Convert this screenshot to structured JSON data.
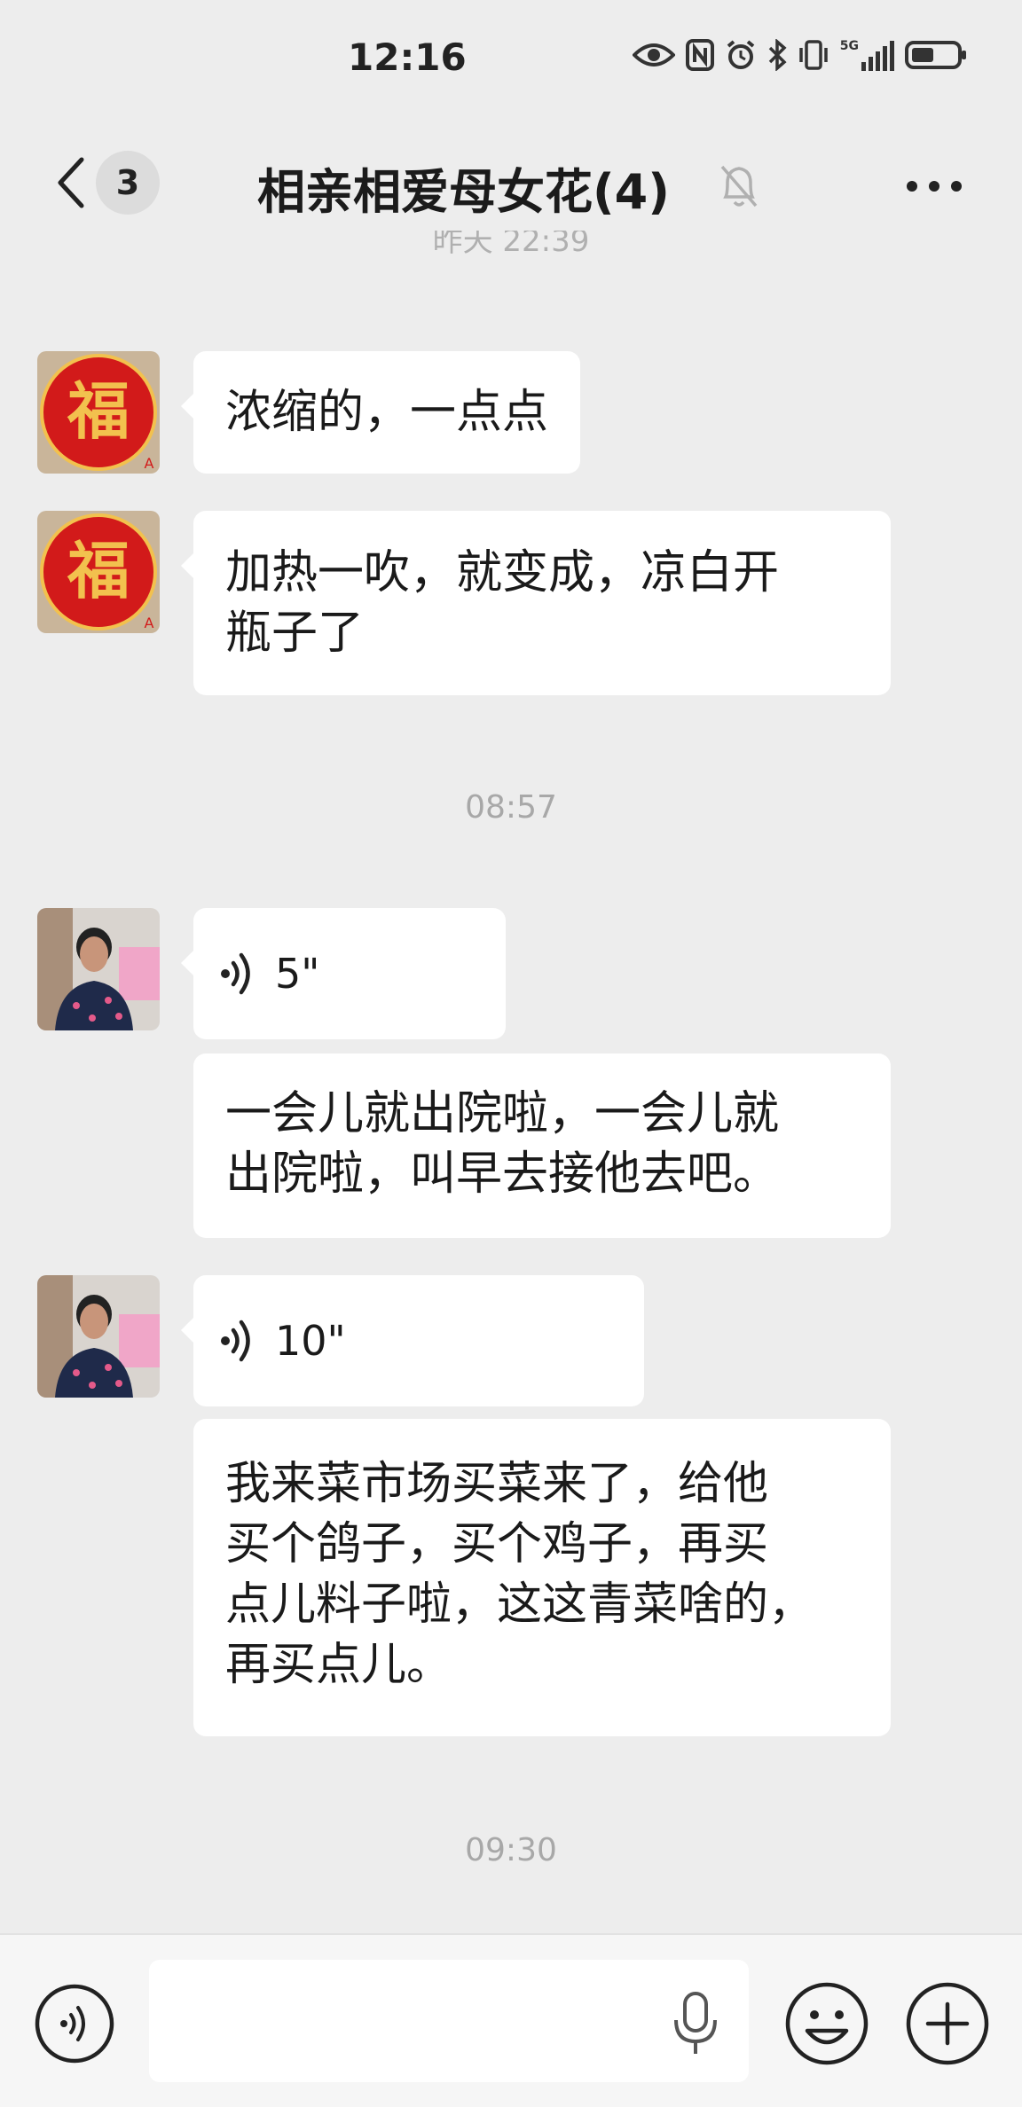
{
  "status_bar": {
    "time": "12:16",
    "network": "5G",
    "icons": [
      "eye-icon",
      "nfc-icon",
      "alarm-icon",
      "bluetooth-icon",
      "vibrate-icon",
      "signal-icon",
      "battery-icon"
    ]
  },
  "header": {
    "unread_count": "3",
    "title": "相亲相爱母女花(4)",
    "icons": [
      "back-icon",
      "mute-bell-icon",
      "more-icon"
    ]
  },
  "cut_timestamp": "昨天 22:39",
  "messages": [
    {
      "type": "text",
      "avatar": "fu-avatar",
      "lines": [
        "浓缩的，一点点"
      ]
    },
    {
      "type": "text",
      "avatar": "fu-avatar",
      "lines": [
        "加热一吹，就变成，凉白开",
        "瓶子了"
      ]
    },
    {
      "type": "timestamp",
      "text": "08:57"
    },
    {
      "type": "voice",
      "avatar": "woman-avatar",
      "duration": "5\"",
      "transcript": [
        "一会儿就出院啦，一会儿就",
        "出院啦，叫早去接他去吧。"
      ]
    },
    {
      "type": "voice",
      "avatar": "woman-avatar",
      "duration": "10\"",
      "transcript": [
        "我来菜市场买菜来了，给他",
        "买个鸽子，买个鸡子，再买",
        "点儿料子啦，这这青菜啥的，",
        "再买点儿。"
      ]
    },
    {
      "type": "timestamp",
      "text": "09:30"
    }
  ],
  "input_bar": {
    "value": "",
    "icons": [
      "voice-mode-icon",
      "microphone-icon",
      "emoji-icon",
      "plus-icon"
    ]
  },
  "colors": {
    "background": "#ededed",
    "bubble": "#ffffff",
    "fu_red": "#d21a1a",
    "fu_gold": "#f2c14e",
    "timestamp": "#a8a8a8"
  }
}
